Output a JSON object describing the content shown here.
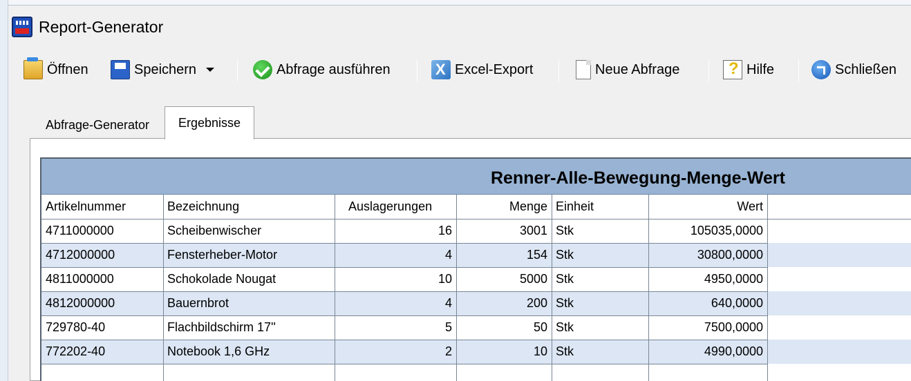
{
  "window": {
    "title": "Report-Generator"
  },
  "toolbar": {
    "open_label": "Öffnen",
    "save_label": "Speichern",
    "run_query_label": "Abfrage ausführen",
    "excel_export_label": "Excel-Export",
    "new_query_label": "Neue Abfrage",
    "help_label": "Hilfe",
    "close_label": "Schließen"
  },
  "tabs": [
    {
      "label": "Abfrage-Generator",
      "active": false
    },
    {
      "label": "Ergebnisse",
      "active": true
    }
  ],
  "report": {
    "title": "Renner-Alle-Bewegung-Menge-Wert",
    "columns": [
      "Artikelnummer",
      "Bezeichnung",
      "Auslagerungen",
      "Menge",
      "Einheit",
      "Wert"
    ],
    "rows": [
      [
        "4711000000",
        "Scheibenwischer",
        "16",
        "3001",
        "Stk",
        "105035,0000"
      ],
      [
        "4712000000",
        "Fensterheber-Motor",
        "4",
        "154",
        "Stk",
        "30800,0000"
      ],
      [
        "4811000000",
        "Schokolade Nougat",
        "10",
        "5000",
        "Stk",
        "4950,0000"
      ],
      [
        "4812000000",
        "Bauernbrot",
        "4",
        "200",
        "Stk",
        "640,0000"
      ],
      [
        "729780-40",
        "Flachbildschirm 17''",
        "5",
        "50",
        "Stk",
        "7500,0000"
      ],
      [
        "772202-40",
        "Notebook 1,6 GHz",
        "2",
        "10",
        "Stk",
        "4990,0000"
      ]
    ]
  },
  "colors": {
    "title_band": "#98b3d3",
    "alt_row": "#dce6f4",
    "grid_line": "#7a8795"
  },
  "icons": {
    "app": "report-generator-icon",
    "open": "folder-open-icon",
    "save": "floppy-disk-icon",
    "run": "green-check-icon",
    "excel": "excel-icon",
    "new": "blank-page-icon",
    "help": "help-icon",
    "close": "blue-close-icon"
  }
}
